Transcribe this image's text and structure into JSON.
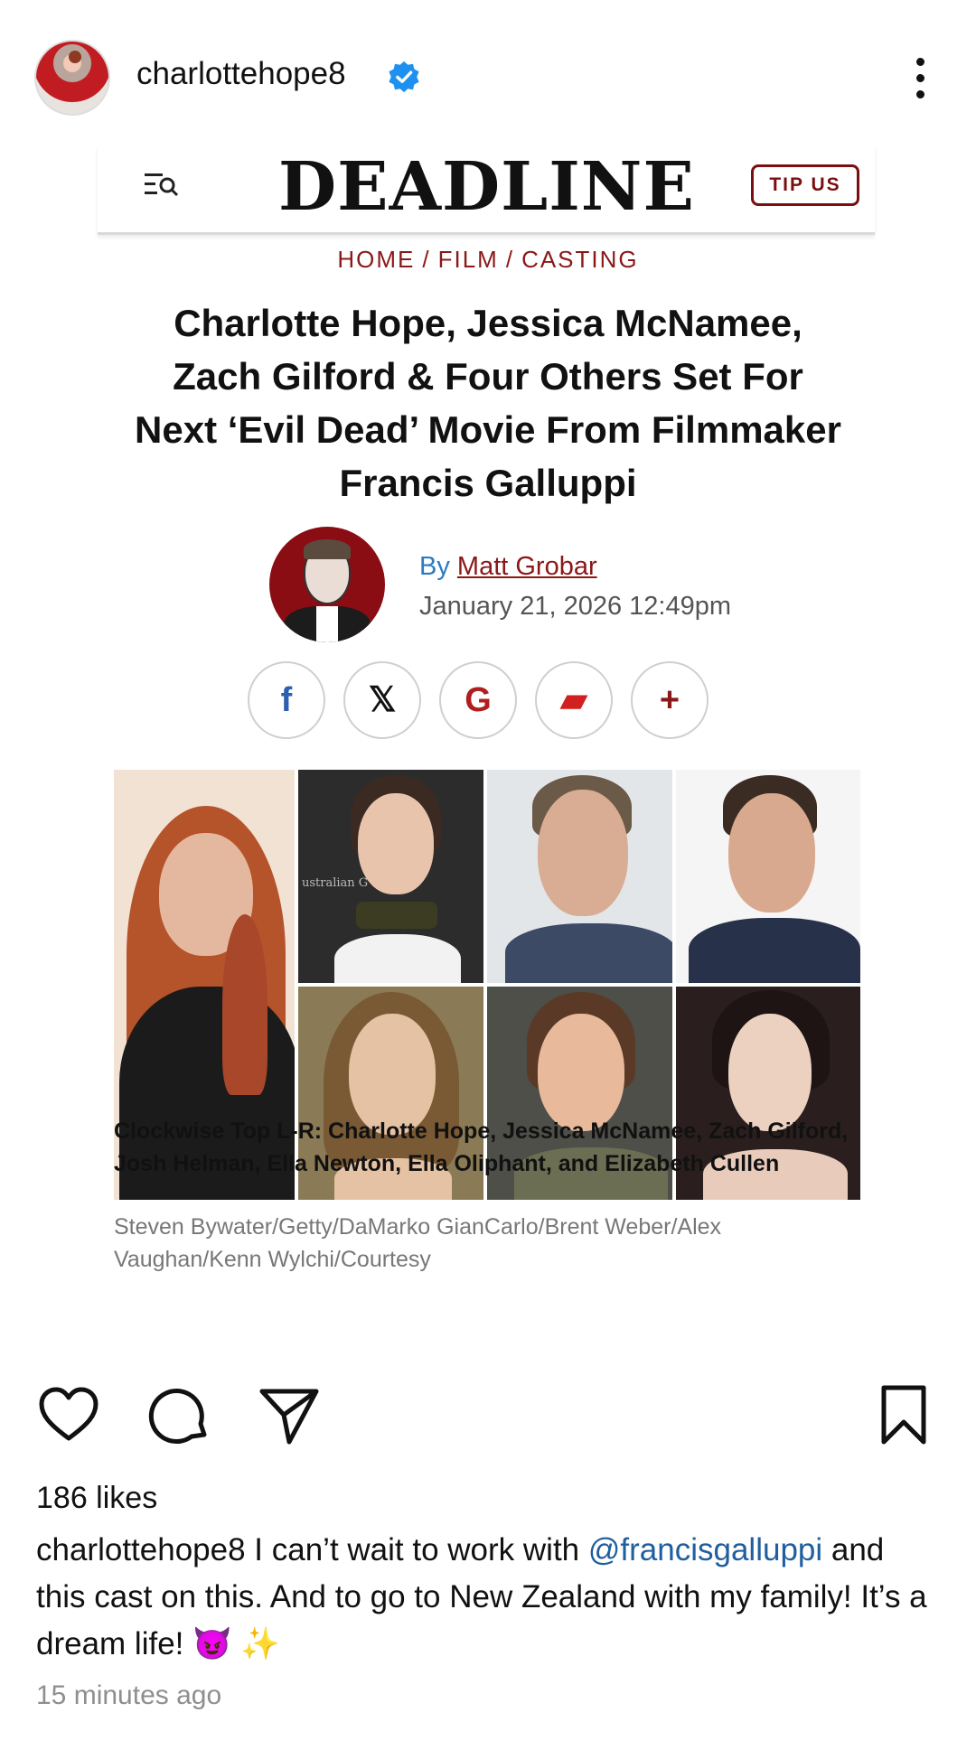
{
  "post": {
    "username": "charlottehope8",
    "verified_icon": "verified-badge-icon",
    "more_icon": "more-options-icon",
    "likes": "186 likes",
    "caption_user": "charlottehope8",
    "caption_text_1": " I can’t wait to work with ",
    "caption_mention": "@francisgalluppi",
    "caption_text_2": " and this cast on this. And to go to New Zealand with my family! It’s a dream life! 😈 ✨",
    "time_ago": "15 minutes ago"
  },
  "article": {
    "brand": "DEADLINE",
    "tip_button": "TIP US",
    "breadcrumb": [
      "HOME",
      "FILM",
      "CASTING"
    ],
    "headline": "Charlotte Hope, Jessica McNamee, Zach Gilford & Four Others Set For Next ‘Evil Dead’ Movie From Filmmaker Francis Galluppi",
    "by_prefix": "By ",
    "author": "Matt Grobar",
    "date": "January 21, 2026 12:49pm",
    "share_buttons": [
      "facebook",
      "x",
      "google",
      "flipboard",
      "more"
    ],
    "share_glyphs": {
      "facebook": "f",
      "x": "𝕏",
      "google": "G",
      "flipboard": "▰",
      "more": "+"
    },
    "caption": "Clockwise Top L-R: Charlotte Hope, Jessica McNamee, Zach Gilford, Josh Helman, Ella Newton, Ella Oliphant, and Elizabeth Cullen",
    "credit": "Steven Bywater/Getty/DaMarko GianCarlo/Brent Weber/Alex Vaughan/Kenn Wylchi/Courtesy",
    "photo_backdrop_text": "ustralian G"
  },
  "colors": {
    "brand_red": "#8a1818",
    "link_blue": "#2b7bc4",
    "mention_blue": "#1f5f9e"
  }
}
